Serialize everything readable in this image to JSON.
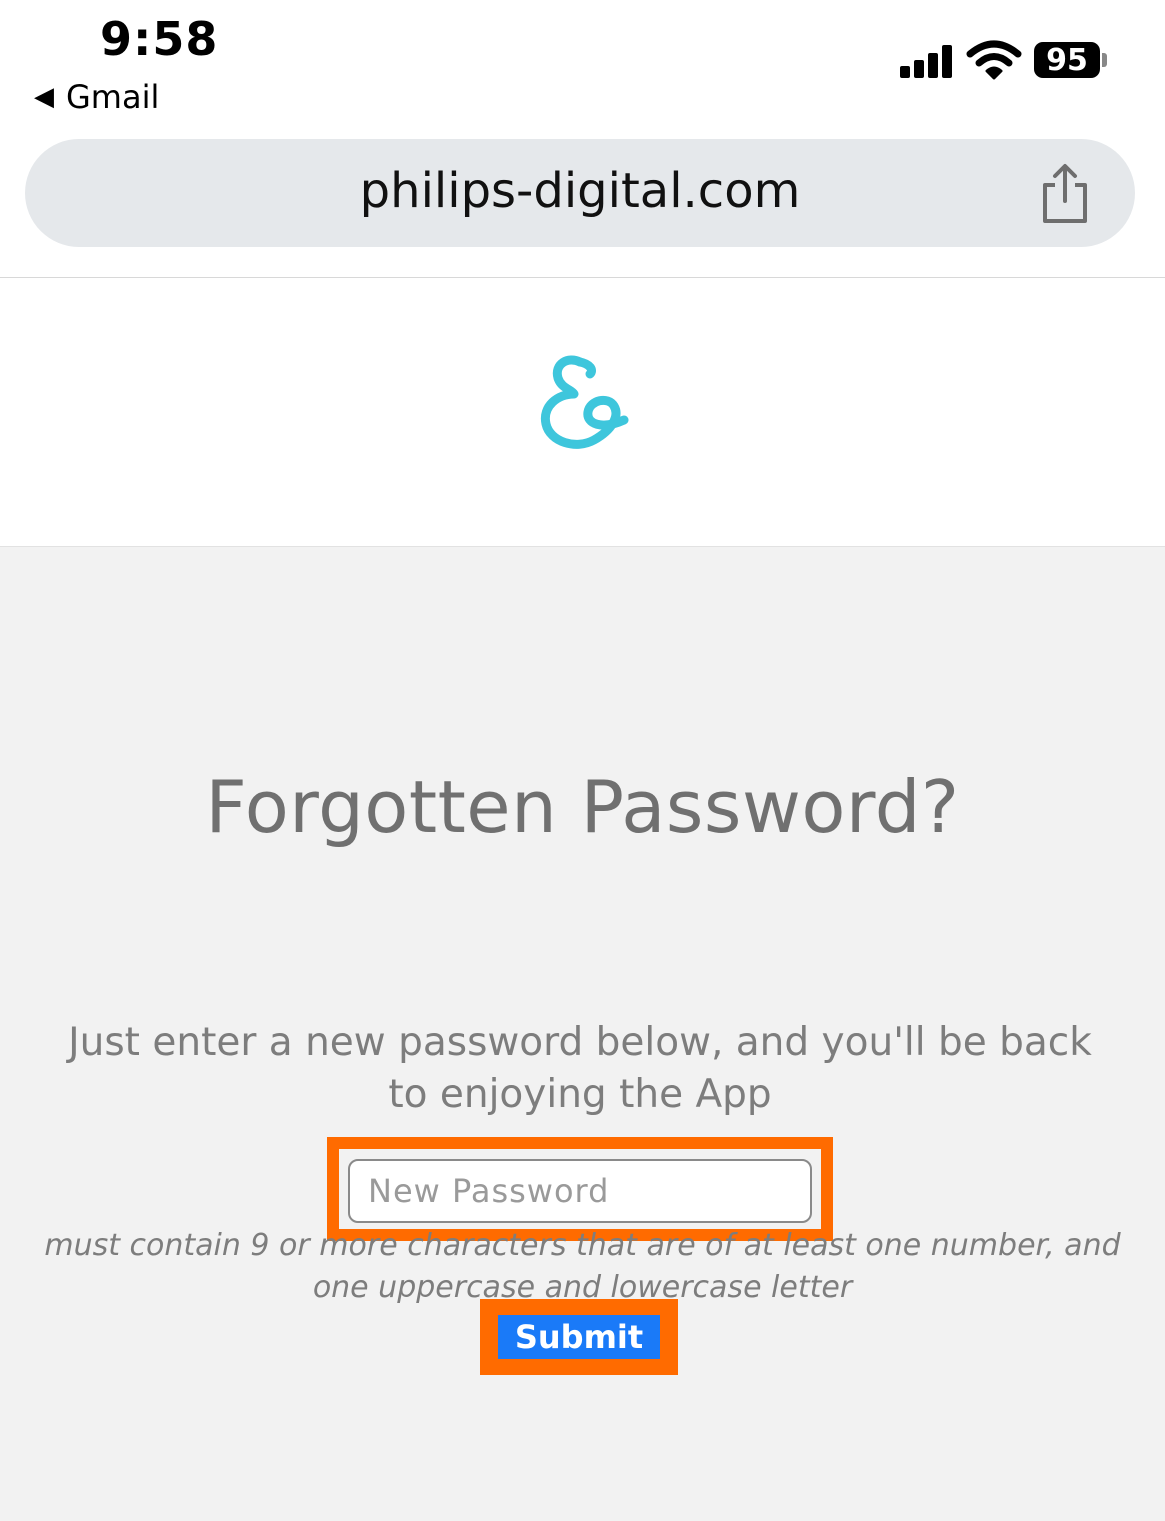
{
  "status_bar": {
    "time": "9:58",
    "back_app": "Gmail",
    "battery": "95"
  },
  "browser": {
    "url": "philips-digital.com"
  },
  "form": {
    "title": "Forgotten Password?",
    "subtitle": "Just enter a new password below, and you'll be back to enjoying the App",
    "password_placeholder": "New Password",
    "hint": "must contain 9 or more characters that are of at least one number, and one uppercase and lowercase letter",
    "submit_label": "Submit"
  },
  "colors": {
    "logo": "#3ec6dc",
    "submit_bg": "#1a7af8",
    "highlight": "#ff6b00",
    "page_bg": "#f2f2f2"
  }
}
